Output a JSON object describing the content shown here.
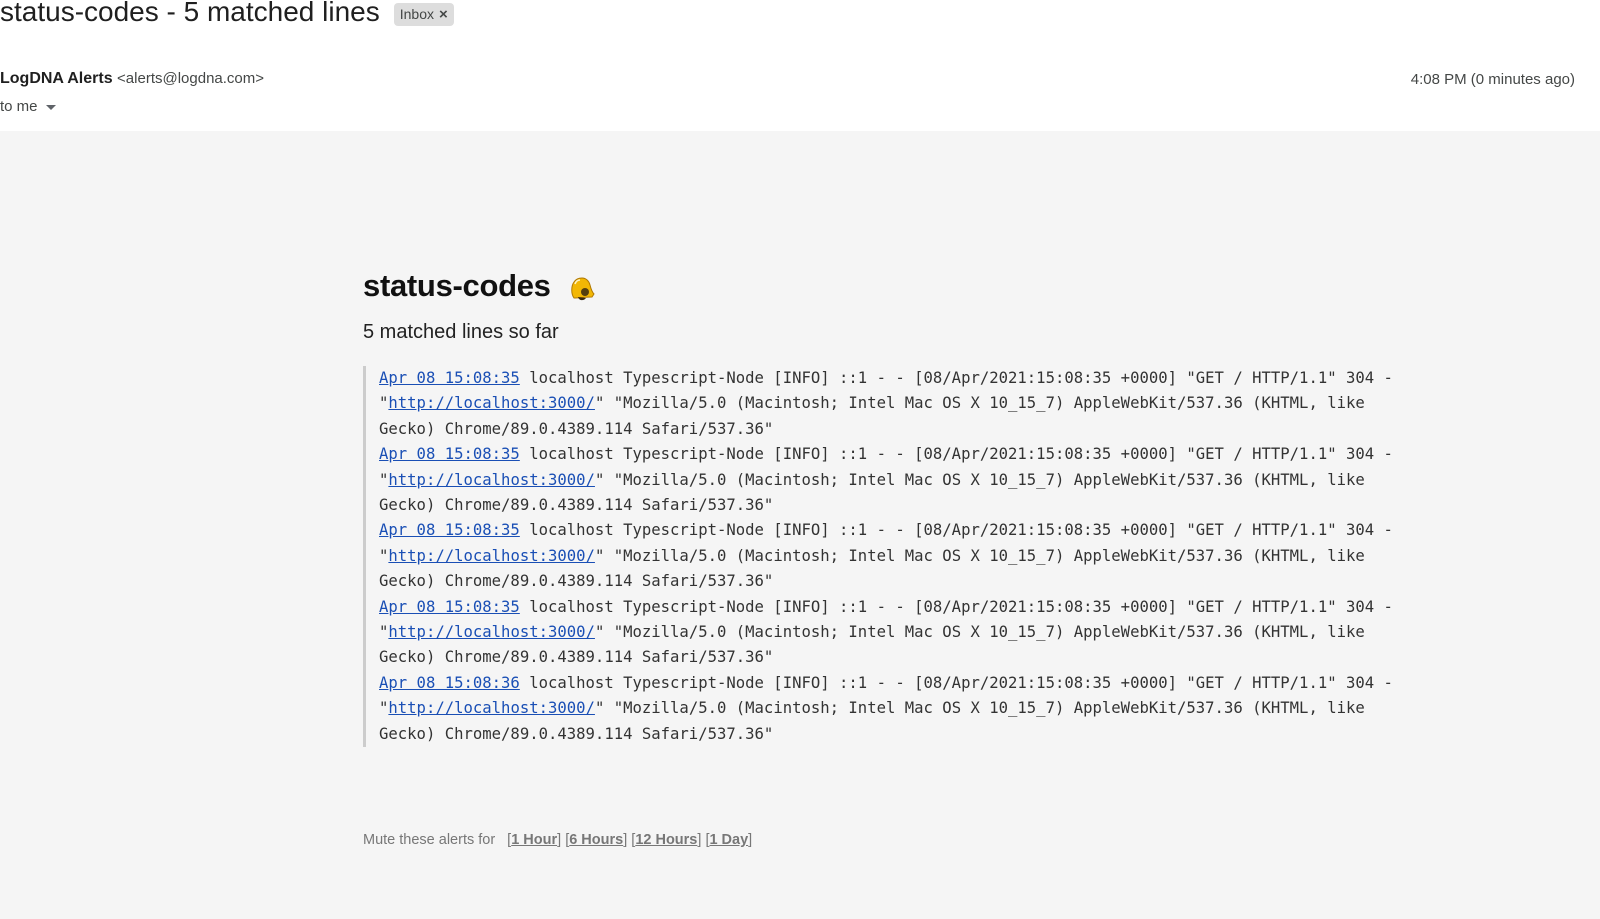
{
  "email": {
    "subject": "status-codes - 5 matched lines",
    "label": "Inbox",
    "sender_name": "LogDNA Alerts",
    "sender_email": "<alerts@logdna.com>",
    "recipient": "to me",
    "time": "4:08 PM (0 minutes ago)"
  },
  "alert": {
    "title": "status-codes",
    "icon": "bell-icon",
    "subtitle": "5 matched lines so far",
    "lines": [
      {
        "timestamp": "Apr 08 15:08:35",
        "before_url": " localhost Typescript-Node [INFO] ::1 - - [08/Apr/2021:15:08:35 +0000] \"GET / HTTP/1.1\" 304 - \"",
        "url": "http://localhost:3000/",
        "after_url": "\" \"Mozilla/5.0 (Macintosh; Intel Mac OS X 10_15_7) AppleWebKit/537.36 (KHTML, like Gecko) Chrome/89.0.4389.114 Safari/537.36\""
      },
      {
        "timestamp": "Apr 08 15:08:35",
        "before_url": " localhost Typescript-Node [INFO] ::1 - - [08/Apr/2021:15:08:35 +0000] \"GET / HTTP/1.1\" 304 - \"",
        "url": "http://localhost:3000/",
        "after_url": "\" \"Mozilla/5.0 (Macintosh; Intel Mac OS X 10_15_7) AppleWebKit/537.36 (KHTML, like Gecko) Chrome/89.0.4389.114 Safari/537.36\""
      },
      {
        "timestamp": "Apr 08 15:08:35",
        "before_url": " localhost Typescript-Node [INFO] ::1 - - [08/Apr/2021:15:08:35 +0000] \"GET / HTTP/1.1\" 304 - \"",
        "url": "http://localhost:3000/",
        "after_url": "\" \"Mozilla/5.0 (Macintosh; Intel Mac OS X 10_15_7) AppleWebKit/537.36 (KHTML, like Gecko) Chrome/89.0.4389.114 Safari/537.36\""
      },
      {
        "timestamp": "Apr 08 15:08:35",
        "before_url": " localhost Typescript-Node [INFO] ::1 - - [08/Apr/2021:15:08:35 +0000] \"GET / HTTP/1.1\" 304 - \"",
        "url": "http://localhost:3000/",
        "after_url": "\" \"Mozilla/5.0 (Macintosh; Intel Mac OS X 10_15_7) AppleWebKit/537.36 (KHTML, like Gecko) Chrome/89.0.4389.114 Safari/537.36\""
      },
      {
        "timestamp": "Apr 08 15:08:36",
        "before_url": " localhost Typescript-Node [INFO] ::1 - - [08/Apr/2021:15:08:35 +0000] \"GET / HTTP/1.1\" 304 - \"",
        "url": "http://localhost:3000/",
        "after_url": "\" \"Mozilla/5.0 (Macintosh; Intel Mac OS X 10_15_7) AppleWebKit/537.36 (KHTML, like Gecko) Chrome/89.0.4389.114 Safari/537.36\""
      }
    ],
    "mute": {
      "label": "Mute these alerts for",
      "options": [
        "1 Hour",
        "6 Hours",
        "12 Hours",
        "1 Day"
      ]
    }
  },
  "colors": {
    "link": "#1a4fb5",
    "body_background": "#f5f5f5",
    "chip_background": "#dddddd",
    "bell": "#f2b705"
  }
}
